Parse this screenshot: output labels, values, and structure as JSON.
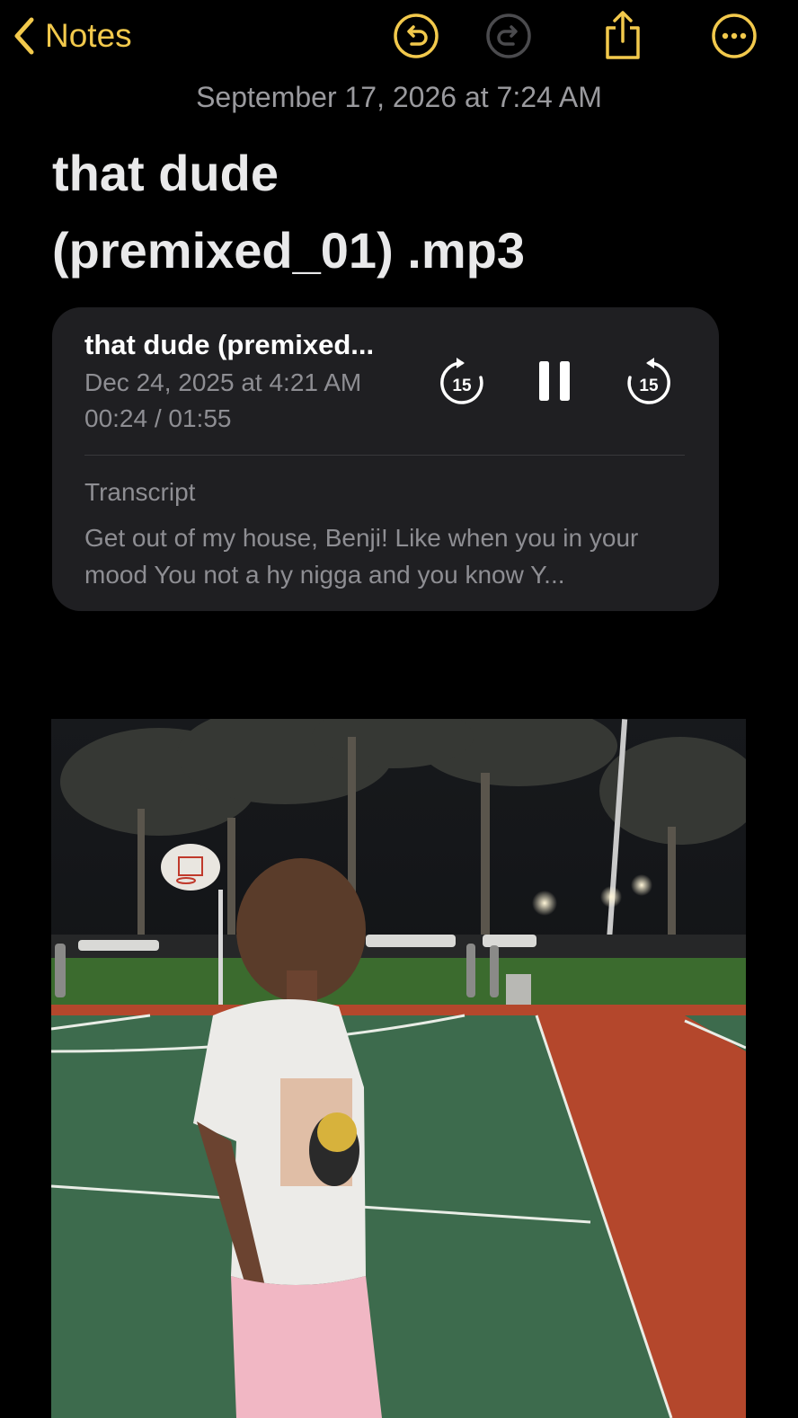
{
  "nav": {
    "back_label": "Notes"
  },
  "toolbar": {
    "undo_icon": "undo-icon",
    "redo_icon": "redo-icon",
    "share_icon": "share-icon",
    "more_icon": "more-icon",
    "accent_color": "#f2c94c"
  },
  "note": {
    "date": "September 17, 2026 at 7:24 AM",
    "title_line1": "that dude",
    "title_line2": "(premixed_01) .mp3"
  },
  "audio": {
    "title": "that dude (premixed...",
    "recorded": "Dec 24, 2025 at 4:21 AM",
    "progress": "00:24 / 01:55",
    "skip_back_seconds": "15",
    "skip_forward_seconds": "15",
    "transcript_label": "Transcript",
    "transcript_text": "Get out of my house, Benji! Like when you in your mood You not a hy nigga and you know Y..."
  },
  "photo": {
    "alt": "photo-attachment"
  }
}
